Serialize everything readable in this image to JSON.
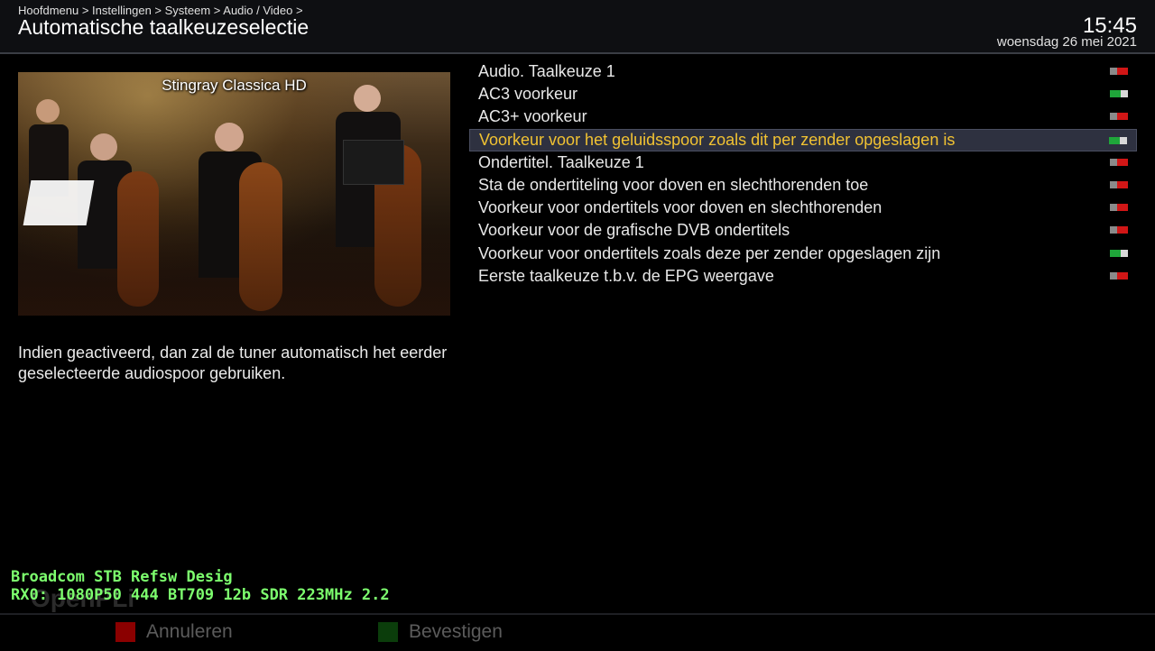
{
  "header": {
    "breadcrumb": "Hoofdmenu > Instellingen > Systeem > Audio / Video >",
    "title": "Automatische taalkeuzeselectie",
    "time": "15:45",
    "date": "woensdag 26 mei 2021"
  },
  "preview": {
    "channel": "Stingray Classica HD"
  },
  "help_text": "Indien geactiveerd, dan zal de tuner automatisch het eerder geselecteerde audiospoor gebruiken.",
  "menu": {
    "selected_index": 3,
    "items": [
      {
        "label": "Audio. Taalkeuze 1",
        "state": "off"
      },
      {
        "label": "AC3 voorkeur",
        "state": "on"
      },
      {
        "label": "AC3+ voorkeur",
        "state": "off"
      },
      {
        "label": "Voorkeur voor het geluidsspoor zoals dit per zender opgeslagen is",
        "state": "on"
      },
      {
        "label": "Ondertitel. Taalkeuze 1",
        "state": "off"
      },
      {
        "label": "Sta de ondertiteling voor doven en slechthorenden toe",
        "state": "off"
      },
      {
        "label": "Voorkeur voor ondertitels voor doven en slechthorenden",
        "state": "off"
      },
      {
        "label": "Voorkeur voor de grafische DVB ondertitels",
        "state": "off"
      },
      {
        "label": "Voorkeur voor ondertitels zoals deze per zender opgeslagen zijn",
        "state": "on"
      },
      {
        "label": "Eerste taalkeuze t.b.v. de EPG weergave",
        "state": "off"
      }
    ]
  },
  "debug": {
    "line1": "Broadcom STB Refsw Desig",
    "line2": "RX0: 1080P50 444 BT709 12b SDR 223MHz 2.2"
  },
  "watermark": "OpenPLi",
  "footer": {
    "cancel_label": "Annuleren",
    "confirm_label": "Bevestigen"
  },
  "colors": {
    "selected_text": "#f1c232",
    "toggle_on": "#1fa63a",
    "toggle_off": "#d11616",
    "cancel_key": "#8b0000",
    "confirm_key": "#0b3d0b",
    "debug_text": "#7dff6e"
  }
}
